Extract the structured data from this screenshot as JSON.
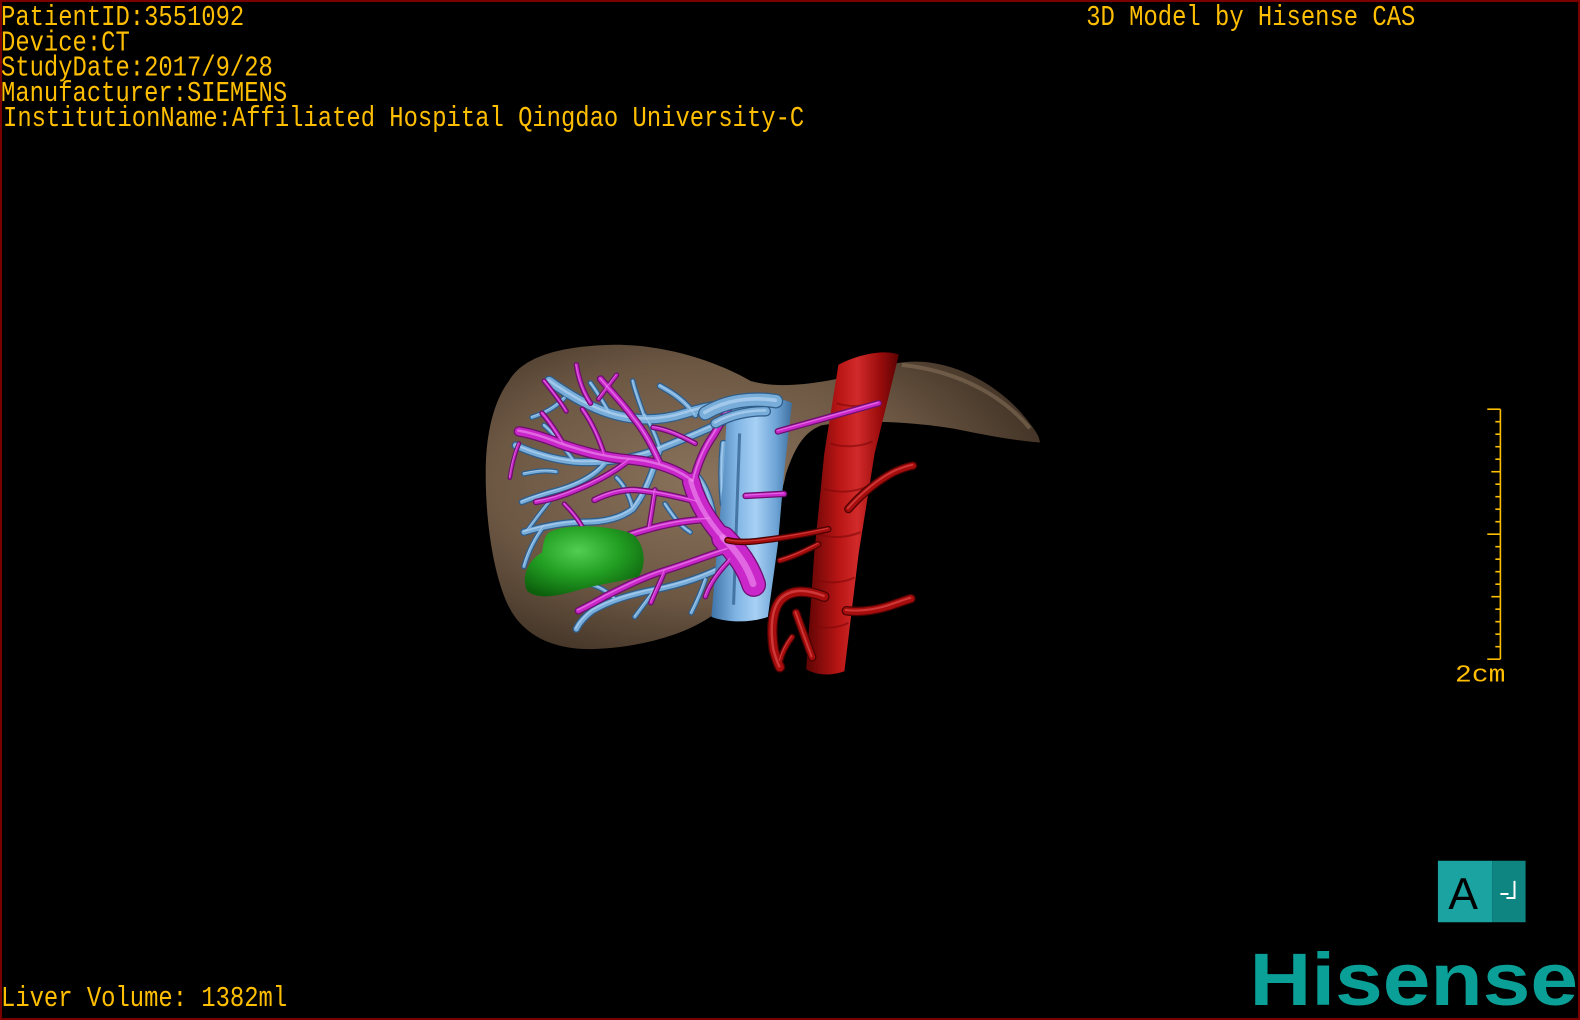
{
  "window": {
    "background": "#000000",
    "frame_color": "#7a0000"
  },
  "overlay": {
    "text_color": "#ffbf00",
    "patient_id": "PatientID:3551092",
    "device": "Device:CT",
    "study_date": "StudyDate:2017/9/28",
    "manufacturer": "Manufacturer:SIEMENS",
    "institution": "InstitutionName:Affiliated Hospital Qingdao University-C",
    "model_credit": "3D Model by Hisense CAS",
    "liver_volume": "Liver Volume: 1382ml"
  },
  "scale_bar": {
    "label": "2cm",
    "color": "#ffbf00"
  },
  "orientation_cube": {
    "front_label": "A",
    "face_color": "#1ba3a1",
    "side_color": "#0f8582",
    "icon": "orientation-cube-icon"
  },
  "logo": {
    "text": "Hisense",
    "color": "#0aa098"
  },
  "model_colors": {
    "liver": "#6c5743",
    "hepatic_vein": "#78acd9",
    "portal_vein": "#c927c9",
    "ivc": "#7fb4e4",
    "aorta": "#b81515",
    "artery_branch": "#a80d0d",
    "lesion": "#23a023"
  }
}
